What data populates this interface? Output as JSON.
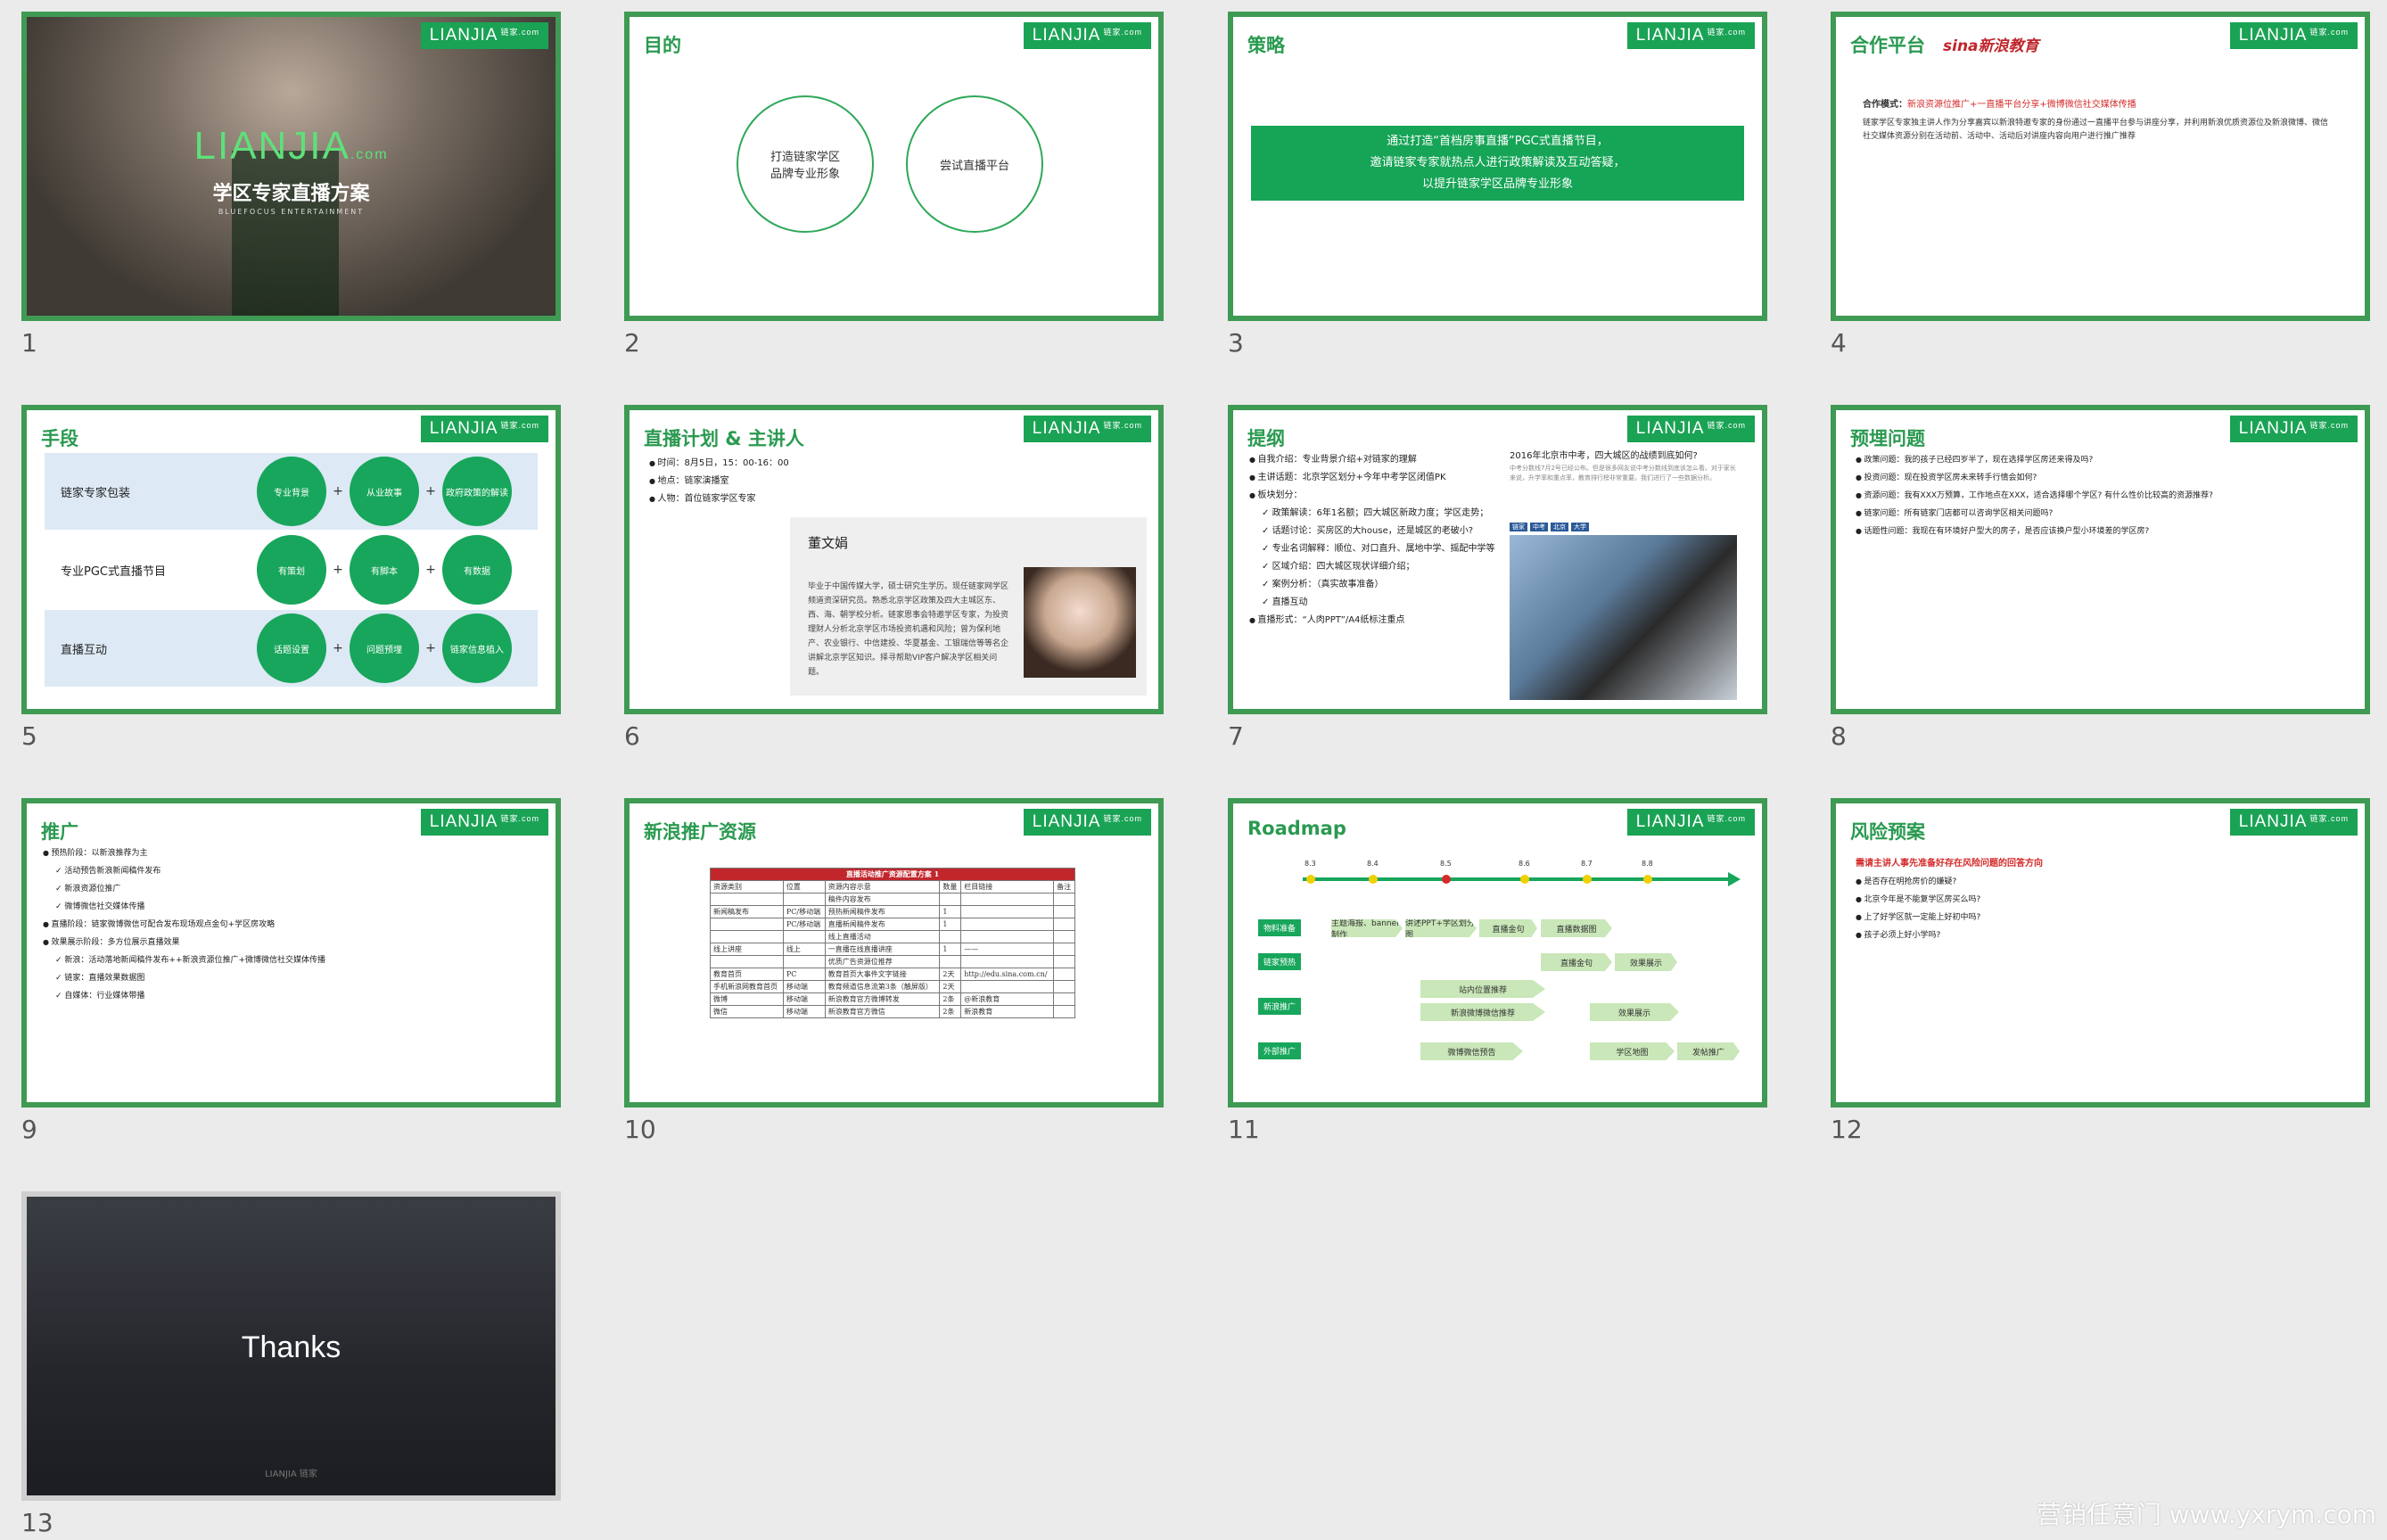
{
  "logo": {
    "text": "LIANJIA",
    "sub": "链家.com"
  },
  "slides": [
    {
      "num": "1",
      "brand": "LIANJIA",
      "brand_cn": "链家",
      "brand_com": ".com",
      "title": "学区专家直播方案",
      "tag": "BLUEFOCUS ENTERTAINMENT"
    },
    {
      "num": "2",
      "title": "目的",
      "circle1": "打造链家学区品牌专业形象",
      "circle2": "尝试直播平台"
    },
    {
      "num": "3",
      "title": "策略",
      "band_line1": "通过打造“首档房事直播”PGC式直播节目，",
      "band_line2": "邀请链家专家就热点人进行政策解读及互动答疑，",
      "band_line3": "以提升链家学区品牌专业形象"
    },
    {
      "num": "4",
      "title": "合作平台",
      "partner": "sina新浪教育",
      "mode_label": "合作模式：",
      "mode_text": "新浪资源位推广+一直播平台分享+微博微信社交媒体传播",
      "desc": "链家学区专家独主讲人作为分享嘉宾以新浪特邀专家的身份通过一直播平台参与讲座分享，并利用新浪优质资源位及新浪微博、微信社交媒体资源分别在活动前、活动中、活动后对讲座内容向用户进行推广推荐"
    },
    {
      "num": "5",
      "title": "手段",
      "rows": [
        {
          "label": "链家专家包装",
          "c1": "专业背景",
          "c2": "从业故事",
          "c3": "政府政策的解读"
        },
        {
          "label": "专业PGC式直播节目",
          "c1": "有策划",
          "c2": "有脚本",
          "c3": "有数据"
        },
        {
          "label": "直播互动",
          "c1": "话题设置",
          "c2": "问题预埋",
          "c3": "链家信息植入"
        }
      ]
    },
    {
      "num": "6",
      "title": "直播计划 & 主讲人",
      "time": "时间：8月5日，15：00-16：00",
      "place": "地点：链家演播室",
      "people": "人物：首位链家学区专家",
      "speaker": "董文娟",
      "bio": "毕业于中国传媒大学，硕士研究生学历。现任链家网学区频道资深研究员。熟悉北京学区政策及四大主城区东、西、海、朝学校分析。链家恩事会特邀学区专家，为投资理财人分析北京学区市场投资机遇和风险；曾为保利地产、农业银行、中信建投、华夏基金、工银瑞信等等名企讲解北京学区知识。择寻帮助VIP客户解决学区相关问题。"
    },
    {
      "num": "7",
      "title": "提纲",
      "items": [
        "自我介绍：专业背景介绍+对链家的理解",
        "主讲话题：北京学区划分+今年中考学区闭值PK",
        "板块划分：",
        "政策解读：6年1名额；四大城区新政力度；学区走势；",
        "话题讨论：买房区的大house，还是城区的老破小?",
        "专业名词解释：顺位、对口直升、属地中学、摇配中学等",
        "区域介绍：四大城区现状详细介绍；",
        "案例分析：（真实故事准备）",
        "直播互动",
        "直播形式：“人肉PPT”/A4纸标注重点"
      ],
      "news_title": "2016年北京市中考，四大城区的战绩到底如何?",
      "news_body": "中考分数线7月2号已经公布。但是很多网友说中考分数线到底该怎么看。对于家长来说，升学率和重点率，教育排行榜非常重要。我们进行了一些数据分析。",
      "news_tags": [
        "链家",
        "中考",
        "北京",
        "大学"
      ]
    },
    {
      "num": "8",
      "title": "预埋问题",
      "items": [
        "政策问题：我的孩子已经四岁半了，现在选择学区房还来得及吗?",
        "投资问题：现在投资学区房未来转手行情会如何?",
        "资源问题：我有XXX万预算，工作地点在XXX，适合选择哪个学区? 有什么性价比较高的资源推荐?",
        "链家问题：所有链家门店都可以咨询学区相关问题吗?",
        "话题性问题：我现在有环境好户型大的房子，是否应该换户型小环境差的学区房?"
      ]
    },
    {
      "num": "9",
      "title": "推广",
      "items": [
        "预热阶段：以新浪推荐为主",
        "活动预告新浪新闻稿件发布",
        "新浪资源位推广",
        "微博微信社交媒体传播",
        "直播阶段：链家微博微信可配合发布现场观点金句+学区房攻略",
        "效果展示阶段：多方位展示直播效果",
        "新浪：活动落地新闻稿件发布++新浪资源位推广+微博微信社交媒体传播",
        "链家：直播效果数据图",
        "自媒体：行业媒体带播"
      ]
    },
    {
      "num": "10",
      "title": "新浪推广资源",
      "table_title": "直播活动推广资源配置方案 1",
      "table_headers": [
        "资源类别",
        "位置",
        "资源内容示意",
        "数量",
        "栏目链接",
        "备注"
      ],
      "table_rows": [
        [
          "",
          "",
          "稿件内容发布",
          "",
          "",
          ""
        ],
        [
          "新闻稿发布",
          "PC/移动端",
          "预热新闻稿件发布",
          "1",
          "",
          ""
        ],
        [
          "",
          "PC/移动端",
          "直播新闻稿件发布",
          "1",
          "",
          ""
        ],
        [
          "",
          "",
          "线上直播活动",
          "",
          "",
          ""
        ],
        [
          "线上讲座",
          "线上",
          "一直播在线直播讲座",
          "1",
          "——",
          ""
        ],
        [
          "",
          "",
          "优质广告资源位推荐",
          "",
          "",
          ""
        ],
        [
          "教育首页",
          "PC",
          "教育首页大事件文字链接",
          "2天",
          "http://edu.sina.com.cn/",
          ""
        ],
        [
          "手机新浪网教育首页",
          "移动端",
          "教育频道信息流第3条（触屏版）",
          "2天",
          "",
          ""
        ],
        [
          "微博",
          "移动端",
          "新浪教育官方微博转发",
          "2条",
          "@新浪教育",
          ""
        ],
        [
          "微信",
          "移动端",
          "新浪教育官方微信",
          "2条",
          "新浪教育",
          ""
        ]
      ]
    },
    {
      "num": "11",
      "title": "Roadmap",
      "dates": [
        "8.3",
        "8.4",
        "8.5",
        "8.6",
        "8.7",
        "8.8"
      ],
      "tags": [
        "物料准备",
        "链家预热",
        "新浪推广",
        "外部推广"
      ],
      "pills": [
        "主题海报、banner制作",
        "讲述PPT+学区划分图",
        "直播金句",
        "直播数据图",
        "直播金句",
        "效果展示",
        "站内位置推荐",
        "新浪微博微信推荐",
        "效果展示",
        "微博微信预告",
        "学区地图",
        "发帖推广"
      ]
    },
    {
      "num": "12",
      "title": "风险预案",
      "lead": "需请主讲人事先准备好存在风险问题的回答方向",
      "items": [
        "是否存在明抢房价的嫌疑?",
        "北京今年是不能复学区房买么吗?",
        "上了好学区就一定能上好初中吗?",
        "孩子必须上好小学吗?"
      ]
    },
    {
      "num": "13",
      "title": "Thanks",
      "brand": "LIANJIA 链家"
    }
  ],
  "watermark": "营销任意门 www.yxrym.com",
  "colors": {
    "green": "#2a9a50",
    "frame": "#3f9a54",
    "red": "#d42a2a",
    "bg": "#ebebeb"
  }
}
